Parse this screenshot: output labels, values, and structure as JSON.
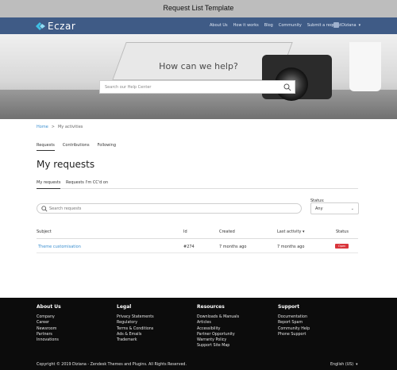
{
  "window": {
    "title": "Request List Template"
  },
  "header": {
    "brand": "Eczar",
    "links": [
      "About Us",
      "How it works",
      "Blog",
      "Community",
      "Submit a request"
    ],
    "user_name": "Diziana",
    "colors": {
      "nav_bg": "#3f5b86",
      "brand_icon": "#3ec1e6"
    }
  },
  "hero": {
    "heading": "How can we help?",
    "search_placeholder": "Search our Help Center"
  },
  "breadcrumb": {
    "home": "Home",
    "separator": ">",
    "current": "My activities"
  },
  "activity_tabs": [
    {
      "label": "Requests",
      "active": true
    },
    {
      "label": "Contributions",
      "active": false
    },
    {
      "label": "Following",
      "active": false
    }
  ],
  "page_title": "My requests",
  "request_tabs": [
    {
      "label": "My requests",
      "active": true
    },
    {
      "label": "Requests I'm CC'd on",
      "active": false
    }
  ],
  "filters": {
    "search_placeholder": "Search requests",
    "status_label": "Status:",
    "status_value": "Any"
  },
  "table": {
    "headers": {
      "subject": "Subject",
      "id": "Id",
      "created": "Created",
      "last_activity": "Last activity ▾",
      "status": "Status"
    },
    "rows": [
      {
        "subject": "Theme customisation",
        "id": "#274",
        "created": "7 months ago",
        "last_activity": "7 months ago",
        "status": "Open"
      }
    ],
    "colors": {
      "open_badge": "#d9353b",
      "link": "#3b8fd0"
    }
  },
  "footer": {
    "columns": [
      {
        "title": "About Us",
        "items": [
          "Company",
          "Career",
          "Newsroom",
          "Partners",
          "Innovations"
        ]
      },
      {
        "title": "Legal",
        "items": [
          "Privacy Statements",
          "Regulatory",
          "Terms & Conditions",
          "Ads & Emails",
          "Trademark"
        ]
      },
      {
        "title": "Resources",
        "items": [
          "Downloads & Manuals",
          "Articles",
          "Accessibility",
          "Partner Opportunity",
          "Warranty Policy",
          "Support Site Map"
        ]
      },
      {
        "title": "Support",
        "items": [
          "Documentation",
          "Report Spam",
          "Community Help",
          "Phone Support"
        ]
      }
    ],
    "copyright": "Copyright © 2019 Diziana - Zendesk Themes and Plugins. All Rights Reserved.",
    "language": "English (US)"
  }
}
